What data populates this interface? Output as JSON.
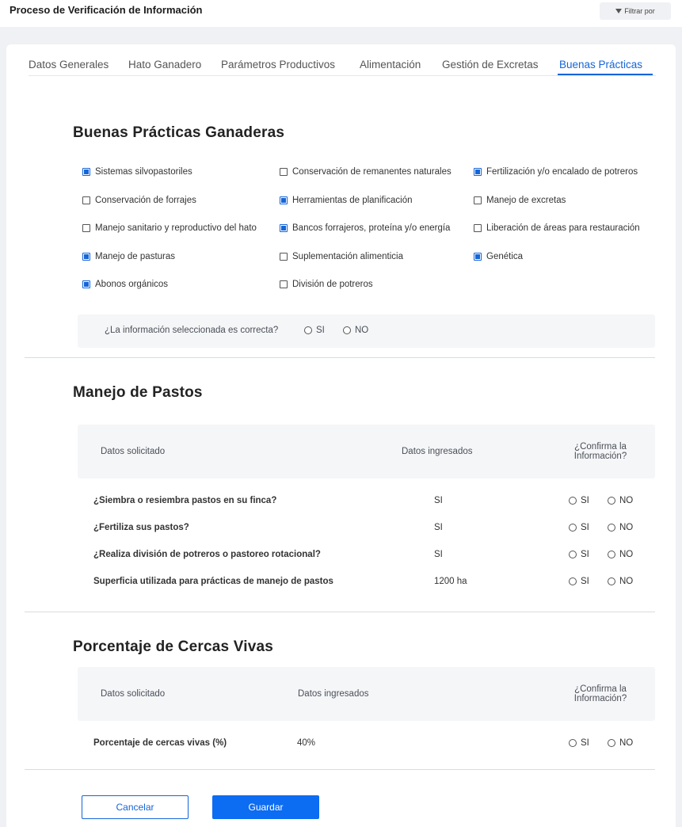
{
  "header": {
    "title": "Proceso de Verificación de Información",
    "filter_label": "Filtrar por",
    "filter_icon": "funnel-icon"
  },
  "tabs": [
    {
      "label": "Datos Generales",
      "active": false
    },
    {
      "label": "Hato Ganadero",
      "active": false
    },
    {
      "label": "Parámetros Productivos",
      "active": false
    },
    {
      "label": "Alimentación",
      "active": false
    },
    {
      "label": "Gestión de Excretas",
      "active": false
    },
    {
      "label": "Buenas Prácticas",
      "active": true
    }
  ],
  "buenas_practicas": {
    "title": "Buenas Prácticas Ganaderas",
    "items": [
      {
        "label": "Sistemas silvopastoriles",
        "checked": true
      },
      {
        "label": "Conservación de remanentes naturales",
        "checked": false
      },
      {
        "label": "Fertilización y/o encalado de potreros",
        "checked": true
      },
      {
        "label": "Conservación de forrajes",
        "checked": false
      },
      {
        "label": "Herramientas de planificación",
        "checked": true
      },
      {
        "label": "Manejo de excretas",
        "checked": false
      },
      {
        "label": "Manejo sanitario y reproductivo del hato",
        "checked": false
      },
      {
        "label": "Bancos forrajeros, proteína y/o energía",
        "checked": true
      },
      {
        "label": "Liberación de áreas para restauración",
        "checked": false
      },
      {
        "label": "Manejo de pasturas",
        "checked": true
      },
      {
        "label": "Suplementación alimenticia",
        "checked": false
      },
      {
        "label": "Genética",
        "checked": true
      },
      {
        "label": "Abonos orgánicos",
        "checked": true
      },
      {
        "label": "División de potreros",
        "checked": false
      }
    ],
    "confirm_question": "¿La información seleccionada es correcta?",
    "yes": "SI",
    "no": "NO"
  },
  "manejo_pastos": {
    "title": "Manejo de Pastos",
    "col_requested": "Datos solicitado",
    "col_entered": "Datos ingresados",
    "col_confirm": "¿Confirma la Información?",
    "rows": [
      {
        "question": "¿Siembra o resiembra pastos en su finca?",
        "value": "SI"
      },
      {
        "question": "¿Fertiliza sus pastos?",
        "value": "SI"
      },
      {
        "question": "¿Realiza división de potreros o pastoreo rotacional?",
        "value": "SI"
      },
      {
        "question": "Superficia utilizada para prácticas de manejo de pastos",
        "value": "1200 ha"
      }
    ],
    "yes": "SI",
    "no": "NO"
  },
  "cercas_vivas": {
    "title": "Porcentaje de Cercas Vivas",
    "col_requested": "Datos solicitado",
    "col_entered": "Datos ingresados",
    "col_confirm": "¿Confirma la Información?",
    "rows": [
      {
        "question": "Porcentaje de cercas vivas (%)",
        "value": "40%"
      }
    ],
    "yes": "SI",
    "no": "NO"
  },
  "actions": {
    "cancel": "Cancelar",
    "save": "Guardar"
  },
  "colors": {
    "accent": "#1565d8",
    "primary_button": "#0c6cf2"
  }
}
